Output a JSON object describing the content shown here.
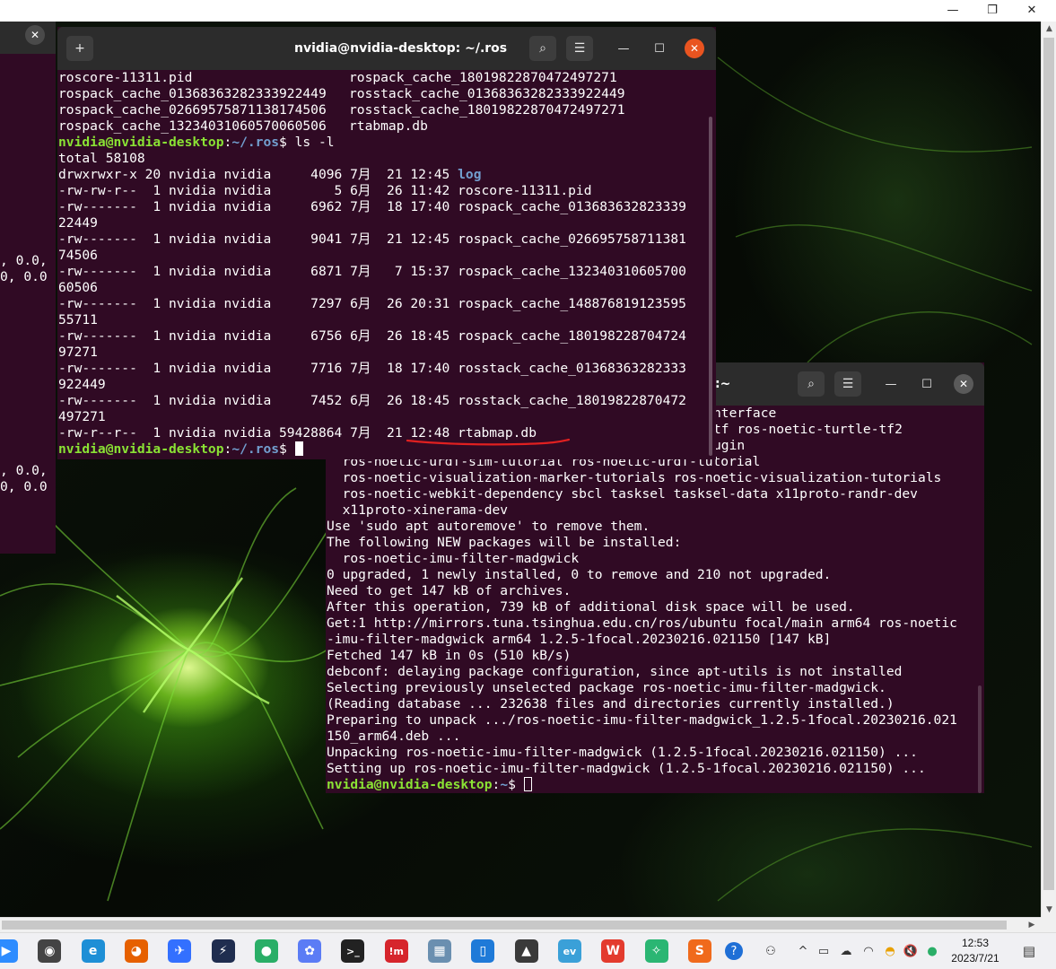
{
  "host_window": {
    "minimize_glyph": "—",
    "restore_glyph": "❐",
    "close_glyph": "✕"
  },
  "background_terminal": {
    "close_glyph": "✕",
    "lines": [
      "",
      "",
      "",
      "",
      "",
      "",
      "",
      "",
      "",
      "",
      "",
      "",
      ", 0.0,",
      "0, 0.0",
      "",
      "",
      "",
      "",
      "",
      "",
      "",
      "",
      "",
      "",
      "",
      ", 0.0,",
      "0, 0.0"
    ]
  },
  "term1": {
    "title": "nvidia@nvidia-desktop: ~/.ros",
    "new_tab_glyph": "+",
    "search_glyph": "⌕",
    "menu_glyph": "☰",
    "minimize_glyph": "—",
    "maximize_glyph": "☐",
    "close_glyph": "✕",
    "close_color": "#e95420",
    "top_lines": [
      {
        "a": "roscore-11311.pid",
        "b": "rospack_cache_18019822870472497271"
      },
      {
        "a": "rospack_cache_01368363282333922449",
        "b": "rosstack_cache_01368363282333922449"
      },
      {
        "a": "rospack_cache_02669575871138174506",
        "b": "rosstack_cache_18019822870472497271"
      },
      {
        "a": "rospack_cache_13234031060570060506",
        "b": "rtabmap.db"
      }
    ],
    "prompt_user": "nvidia@nvidia-desktop",
    "prompt_sep": ":",
    "prompt_path": "~/.ros",
    "prompt_dollar": "$ ",
    "command": "ls -l",
    "total": "total 58108",
    "entries": [
      {
        "meta": "drwxrwxr-x 20 nvidia nvidia     4096 7月  21 12:45 ",
        "name": "log",
        "dir": true
      },
      {
        "meta": "-rw-rw-r--  1 nvidia nvidia        5 6月  26 11:42 ",
        "name": "roscore-11311.pid",
        "dir": false
      },
      {
        "meta": "-rw-------  1 nvidia nvidia     6962 7月  18 17:40 ",
        "name": "rospack_cache_013683632823339",
        "dir": false
      },
      {
        "meta": "",
        "name": "22449",
        "dir": false
      },
      {
        "meta": "-rw-------  1 nvidia nvidia     9041 7月  21 12:45 ",
        "name": "rospack_cache_026695758711381",
        "dir": false
      },
      {
        "meta": "",
        "name": "74506",
        "dir": false
      },
      {
        "meta": "-rw-------  1 nvidia nvidia     6871 7月   7 15:37 ",
        "name": "rospack_cache_132340310605700",
        "dir": false
      },
      {
        "meta": "",
        "name": "60506",
        "dir": false
      },
      {
        "meta": "-rw-------  1 nvidia nvidia     7297 6月  26 20:31 ",
        "name": "rospack_cache_148876819123595",
        "dir": false
      },
      {
        "meta": "",
        "name": "55711",
        "dir": false
      },
      {
        "meta": "-rw-------  1 nvidia nvidia     6756 6月  26 18:45 ",
        "name": "rospack_cache_180198228704724",
        "dir": false
      },
      {
        "meta": "",
        "name": "97271",
        "dir": false
      },
      {
        "meta": "-rw-------  1 nvidia nvidia     7716 7月  18 17:40 ",
        "name": "rosstack_cache_01368363282333",
        "dir": false
      },
      {
        "meta": "",
        "name": "922449",
        "dir": false
      },
      {
        "meta": "-rw-------  1 nvidia nvidia     7452 6月  26 18:45 ",
        "name": "rosstack_cache_18019822870472",
        "dir": false
      },
      {
        "meta": "",
        "name": "497271",
        "dir": false
      },
      {
        "meta": "-rw-r--r--  1 nvidia nvidia 59428864 7月  21 12:48 ",
        "name": "rtabmap.db",
        "dir": false
      }
    ]
  },
  "term2": {
    "title_fragment": ":~",
    "search_glyph": "⌕",
    "menu_glyph": "☰",
    "minimize_glyph": "—",
    "maximize_glyph": "☐",
    "close_glyph": "✕",
    "close_color": "#5a5a5a",
    "partial_lines": [
      "nterface",
      "tf ros-noetic-turtle-tf2",
      "ugin"
    ],
    "lines": [
      "  ros-noetic-urdf-sim-tutorial ros-noetic-urdf-tutorial",
      "  ros-noetic-visualization-marker-tutorials ros-noetic-visualization-tutorials",
      "  ros-noetic-webkit-dependency sbcl tasksel tasksel-data x11proto-randr-dev",
      "  x11proto-xinerama-dev",
      "Use 'sudo apt autoremove' to remove them.",
      "The following NEW packages will be installed:",
      "  ros-noetic-imu-filter-madgwick",
      "0 upgraded, 1 newly installed, 0 to remove and 210 not upgraded.",
      "Need to get 147 kB of archives.",
      "After this operation, 739 kB of additional disk space will be used.",
      "Get:1 http://mirrors.tuna.tsinghua.edu.cn/ros/ubuntu focal/main arm64 ros-noetic",
      "-imu-filter-madgwick arm64 1.2.5-1focal.20230216.021150 [147 kB]",
      "Fetched 147 kB in 0s (510 kB/s)",
      "debconf: delaying package configuration, since apt-utils is not installed",
      "Selecting previously unselected package ros-noetic-imu-filter-madgwick.",
      "(Reading database ... 232638 files and directories currently installed.)",
      "Preparing to unpack .../ros-noetic-imu-filter-madgwick_1.2.5-1focal.20230216.021",
      "150_arm64.deb ...",
      "Unpacking ros-noetic-imu-filter-madgwick (1.2.5-1focal.20230216.021150) ...",
      "Setting up ros-noetic-imu-filter-madgwick (1.2.5-1focal.20230216.021150) ..."
    ],
    "prompt_user": "nvidia@nvidia-desktop",
    "prompt_sep": ":",
    "prompt_path": "~",
    "prompt_dollar": "$ "
  },
  "taskbar": {
    "apps": [
      {
        "name": "zoom-icon",
        "glyph": "▶",
        "color": "#2d8cff"
      },
      {
        "name": "camera-icon",
        "glyph": "◉",
        "color": "#444444"
      },
      {
        "name": "edge-browser-icon",
        "glyph": "e",
        "color": "#1e8fd6"
      },
      {
        "name": "firefox-icon",
        "glyph": "◕",
        "color": "#e66000"
      },
      {
        "name": "feishu-icon",
        "glyph": "✈",
        "color": "#3370ff"
      },
      {
        "name": "powershell-icon",
        "glyph": "⚡",
        "color": "#1f2d4f"
      },
      {
        "name": "wechat-icon",
        "glyph": "●",
        "color": "#2aae67"
      },
      {
        "name": "photos-icon",
        "glyph": "✿",
        "color": "#5b7cf5"
      },
      {
        "name": "terminal-icon",
        "glyph": ">_",
        "color": "#222222"
      },
      {
        "name": "adobe-app-icon",
        "glyph": "!m",
        "color": "#d6252c"
      },
      {
        "name": "screenshot-tool-icon",
        "glyph": "▦",
        "color": "#6a8fb0"
      },
      {
        "name": "phone-link-icon",
        "glyph": "▯",
        "color": "#1f7ad8"
      },
      {
        "name": "image-viewer-icon",
        "glyph": "▲",
        "color": "#3a3a3a"
      },
      {
        "name": "everything-search-icon",
        "glyph": "ev",
        "color": "#3aa0d8"
      },
      {
        "name": "wps-office-icon",
        "glyph": "W",
        "color": "#e33b2e"
      },
      {
        "name": "pycharm-like-icon",
        "glyph": "✧",
        "color": "#2bb673"
      },
      {
        "name": "wps-slides-icon",
        "glyph": "S",
        "color": "#f06a1c"
      }
    ],
    "tray": [
      {
        "name": "help-icon",
        "glyph": "?"
      },
      {
        "name": "people-icon",
        "glyph": "⚇"
      },
      {
        "name": "show-hidden-icons",
        "glyph": "^"
      },
      {
        "name": "battery-icon",
        "glyph": "▭"
      },
      {
        "name": "sync-icon",
        "glyph": "☁"
      },
      {
        "name": "wifi-icon",
        "glyph": "◠"
      },
      {
        "name": "qq-icon",
        "glyph": "◓"
      },
      {
        "name": "volume-muted-icon",
        "glyph": "🔇"
      },
      {
        "name": "wechat-tray-icon",
        "glyph": "●"
      }
    ],
    "time": "12:53",
    "date": "2023/7/21",
    "notification_glyph": "▤"
  }
}
